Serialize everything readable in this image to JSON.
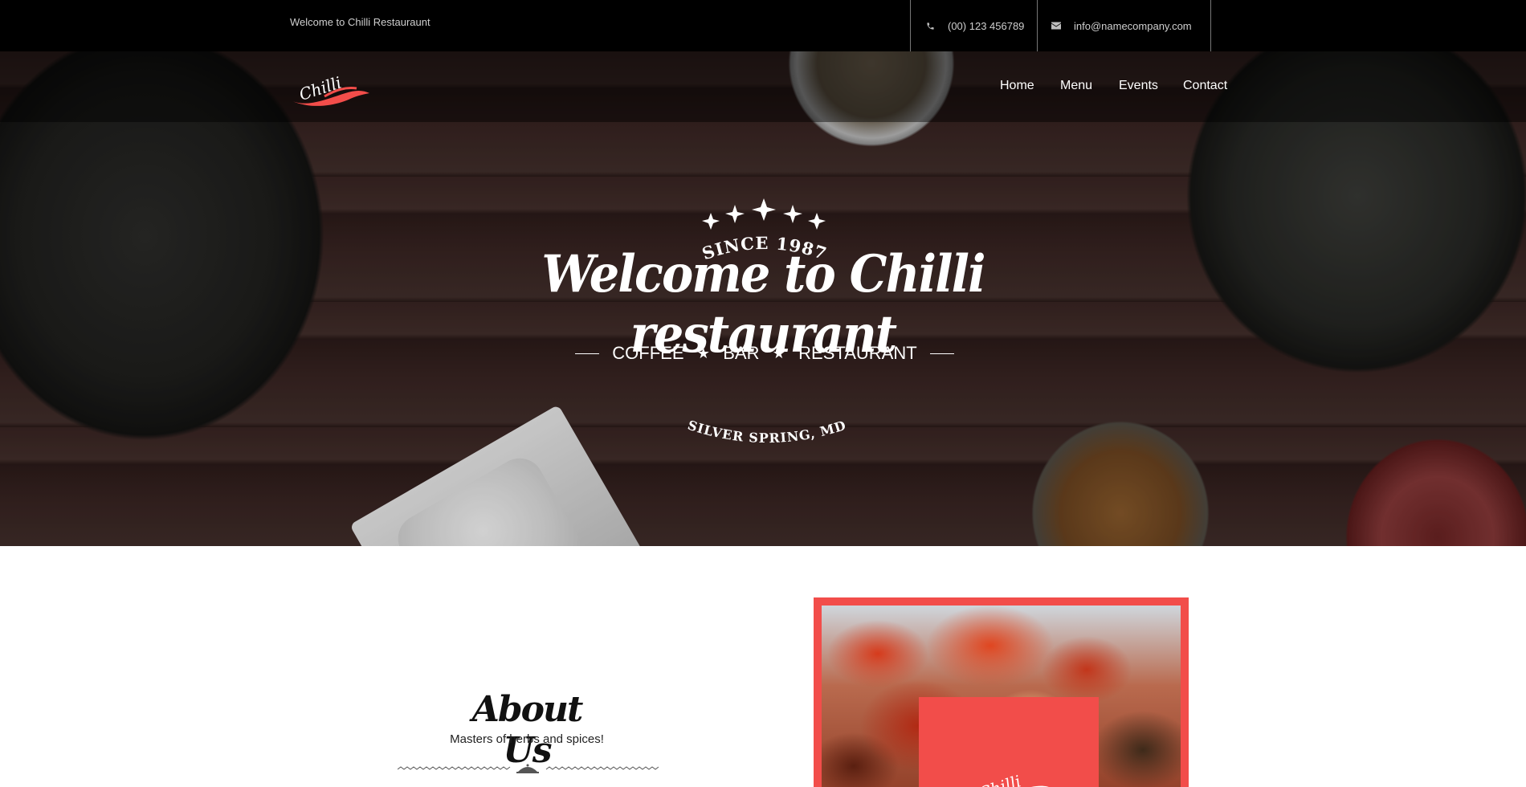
{
  "topbar": {
    "welcome": "Welcome to Chilli Restauraunt",
    "phone": "(00) 123 456789",
    "phone_icon": "phone-icon",
    "email": "info@namecompany.com",
    "email_icon": "envelope-icon"
  },
  "brand": {
    "logo_text": "Chilli",
    "accent": "#f24d4a"
  },
  "nav": {
    "items": [
      {
        "label": "Home"
      },
      {
        "label": "Menu"
      },
      {
        "label": "Events"
      },
      {
        "label": "Contact"
      }
    ]
  },
  "hero": {
    "since": "SINCE 1987",
    "title": "Welcome to Chilli restaurant",
    "tagline": [
      "COFFEE",
      "BAR",
      "RESTAURANT"
    ],
    "tagline_separator_icon": "star-icon",
    "location": "SILVER SPRING, MD"
  },
  "about": {
    "title": "About Us",
    "subtitle": "Masters of herbs and spices!",
    "divider_icon": "cloche-icon"
  }
}
